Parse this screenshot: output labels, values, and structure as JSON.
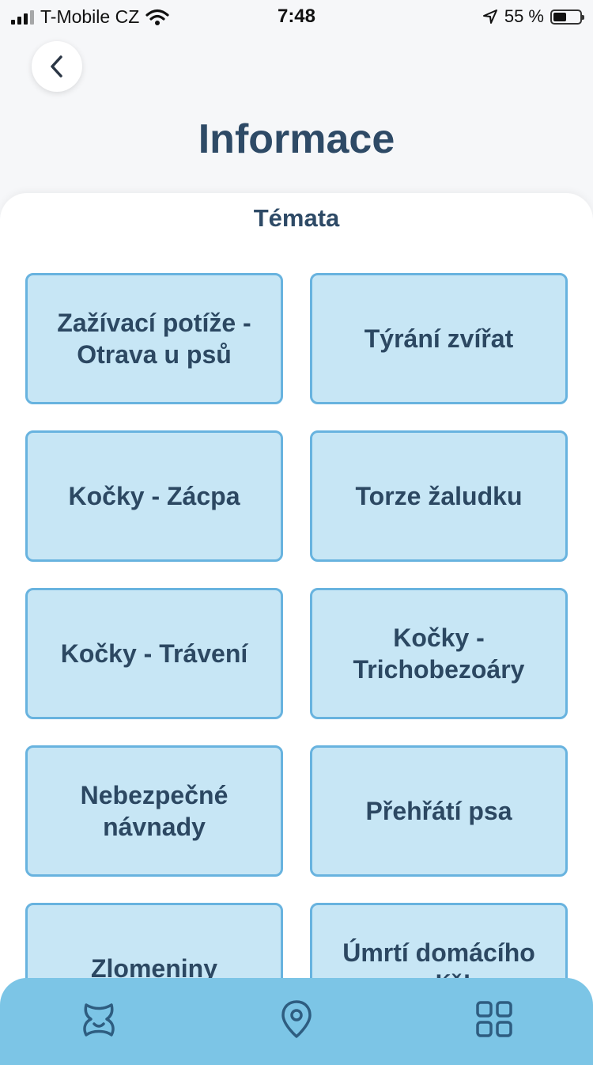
{
  "status_bar": {
    "carrier": "T-Mobile CZ",
    "time": "7:48",
    "battery": "55 %",
    "battery_level": 0.55
  },
  "header": {
    "title": "Informace",
    "back_icon": "chevron-left-icon"
  },
  "section": {
    "title": "Témata"
  },
  "topics": [
    {
      "label": "Zažívací potíže - Otrava u psů"
    },
    {
      "label": "Týrání zvířat"
    },
    {
      "label": "Kočky - Zácpa"
    },
    {
      "label": "Torze žaludku"
    },
    {
      "label": "Kočky - Trávení"
    },
    {
      "label": "Kočky - Trichobezoáry"
    },
    {
      "label": "Nebezpečné návnady"
    },
    {
      "label": "Přehřátí psa"
    },
    {
      "label": "Zlomeniny"
    },
    {
      "label": "Úmrtí domácího mazlíčka"
    }
  ],
  "nav": {
    "items": [
      {
        "icon": "pet-icon"
      },
      {
        "icon": "location-pin-icon"
      },
      {
        "icon": "grid-icon"
      }
    ]
  },
  "colors": {
    "title": "#2e4a66",
    "tile_fill": "#c7e6f5",
    "tile_border": "#68b3df",
    "nav_bg": "#7cc5e6",
    "nav_icon": "#2e5d80"
  }
}
